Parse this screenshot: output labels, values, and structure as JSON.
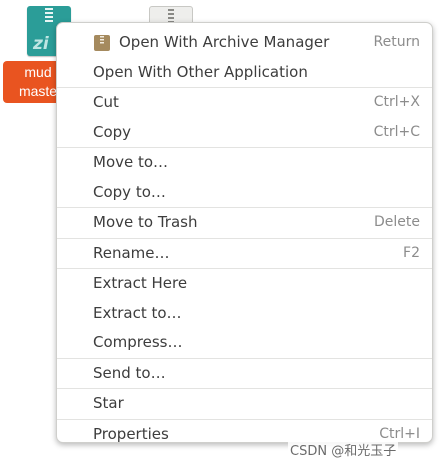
{
  "desktop": {
    "file_icon": {
      "icon": "zip-archive-icon",
      "glyph_text": "zi",
      "label_lines": [
        "mud",
        "maste"
      ],
      "label_color": "#e95420"
    },
    "second_icon": {
      "icon": "zip-archive-icon"
    }
  },
  "context_menu": {
    "groups": [
      [
        {
          "label": "Open With Archive Manager",
          "accel": "Return",
          "icon": "archive-manager-icon"
        },
        {
          "label": "Open With Other Application",
          "accel": ""
        }
      ],
      [
        {
          "label": "Cut",
          "accel": "Ctrl+X"
        },
        {
          "label": "Copy",
          "accel": "Ctrl+C"
        }
      ],
      [
        {
          "label": "Move to…",
          "accel": ""
        },
        {
          "label": "Copy to…",
          "accel": ""
        }
      ],
      [
        {
          "label": "Move to Trash",
          "accel": "Delete"
        }
      ],
      [
        {
          "label": "Rename…",
          "accel": "F2"
        }
      ],
      [
        {
          "label": "Extract Here",
          "accel": ""
        },
        {
          "label": "Extract to…",
          "accel": ""
        },
        {
          "label": "Compress…",
          "accel": ""
        }
      ],
      [
        {
          "label": "Send to…",
          "accel": ""
        }
      ],
      [
        {
          "label": "Star",
          "accel": ""
        }
      ],
      [
        {
          "label": "Properties",
          "accel": "Ctrl+I"
        }
      ]
    ]
  },
  "watermark": {
    "text": "CSDN @和光玉子"
  }
}
